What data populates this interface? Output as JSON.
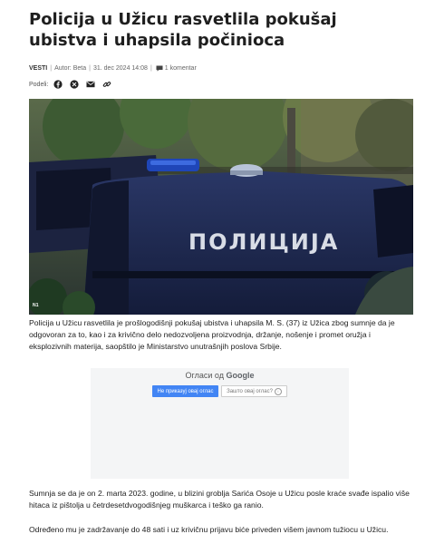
{
  "article": {
    "title": "Policija u Užicu rasvetlila pokušaj ubistva i uhapsila počinioca",
    "category": "VESTI",
    "author_label": "Autor:",
    "author": "Beta",
    "date": "31. dec 2024 14:08",
    "comments": "1 komentar",
    "share_label": "Podeli:",
    "share_icons": [
      "facebook-icon",
      "x-icon",
      "email-icon",
      "link-icon"
    ],
    "photo_credit": "N1",
    "van_text": "ПОЛИЦИЈА",
    "paragraphs": [
      "Policija u Užicu rasvetlila je prošlogodišnji pokušaj ubistva i uhapsila M. S. (37) iz Užica zbog sumnje da je odgovoran za to, kao i za krivično delo nedozvoljena proizvodnja, držanje, nošenje i promet oružja i eksplozivnih materija, saopštilo je Ministarstvo unutrašnjih poslova Srbije.",
      "Sumnja se da je on 2. marta 2023. godine, u blizini groblja Sarića Osoje u Užicu posle kraće svađe ispalio više hitaca iz pištolja u četrdesetdvogodišnjeg muškarca i teško ga ranio.",
      "Određeno mu je zadržavanje do 48 sati i uz krivičnu prijavu biće priveden višem javnom tužiocu u Užicu."
    ]
  },
  "ad": {
    "title_prefix": "Огласи од",
    "title_brand": "Google",
    "stop_button": "Не приказуј овај оглас",
    "why_button": "Зашто овај оглас?"
  },
  "colors": {
    "ad_button": "#4285f4",
    "van_body": "#1e2a52"
  }
}
